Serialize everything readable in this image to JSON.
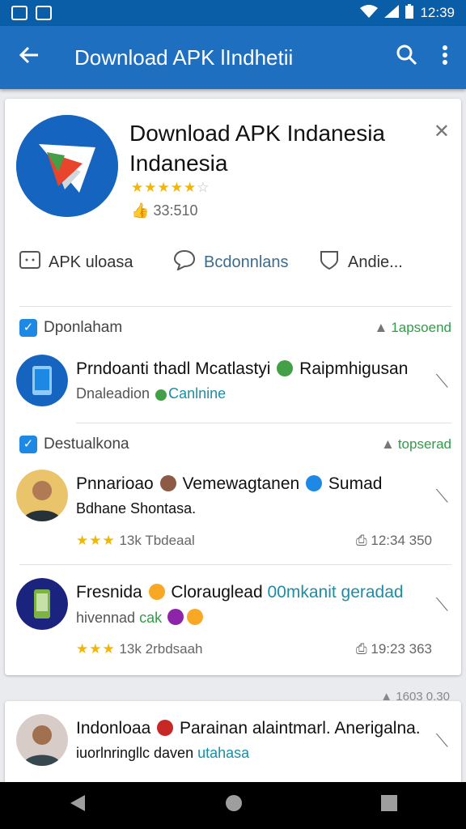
{
  "status_bar": {
    "time": "12:39",
    "icons": [
      "wifi-icon",
      "signal-icon",
      "battery-icon"
    ]
  },
  "app_bar": {
    "title": "Download APK lIndhetii",
    "icons": [
      "back-arrow-icon",
      "search-icon",
      "more-vert-icon"
    ]
  },
  "header": {
    "title": "Download APK Indanesia Indanesia",
    "rating_stars": 4.5,
    "likes": "33:510"
  },
  "actions": [
    {
      "label": "APK uloasa",
      "icon": "apk-icon"
    },
    {
      "label": "Bcdonnlans",
      "icon": "comment-icon"
    },
    {
      "label": "Andie...",
      "icon": "shield-icon"
    }
  ],
  "sections": [
    {
      "label": "Dponlaham",
      "tag": "1apsoend"
    },
    {
      "label": "Destualkona",
      "tag": "topserad"
    }
  ],
  "items": [
    {
      "line1": "Prndoanti thadl Mcatlastyi",
      "line1b": "Raipmhigusan",
      "line2": "Dnaleadion",
      "line2b": "Canlnine"
    },
    {
      "line1": "Pnnarioao",
      "line1b": "Vemewagtanen",
      "line1c": "Sumad",
      "line2": "Bdhane Shontasa.",
      "rating": "13k",
      "rating_label": "Tbdeaal",
      "downloads": "12:34 350"
    },
    {
      "line1": "Fresnida",
      "line1b": "Clorauglead",
      "line1c": "00mkanit geradad",
      "line2": "hivennad",
      "line2b": "cak",
      "rating": "13k",
      "rating_label": "2rbdsaah",
      "downloads": "19:23 363"
    }
  ],
  "card2": {
    "tag": "1603 0.30",
    "line1": "Indonloaa",
    "line1b": "Parainan alaintmarl. Anerigalna.",
    "line2": "iuorlnringllc daven",
    "line2b": "utahasa"
  },
  "colors": {
    "status_bar": "#0a5ea8",
    "app_bar": "#1f6fc0",
    "accent_green": "#2e9d45",
    "star": "#f2b705"
  }
}
